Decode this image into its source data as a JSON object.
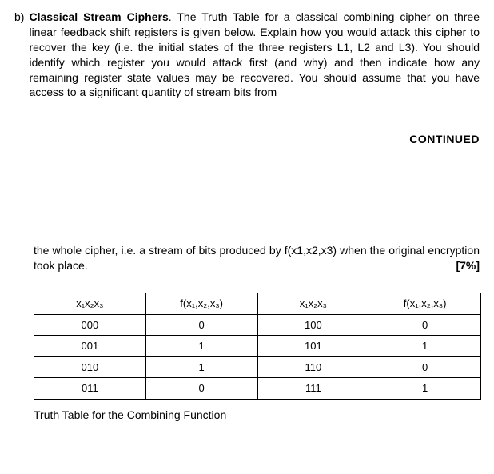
{
  "question": {
    "label": "b)",
    "title": "Classical Stream Ciphers",
    "text1": ". The Truth Table for a classical combining cipher on three linear feedback shift registers is given below. Explain how you would attack this cipher to recover the key (i.e. the initial states of the three registers L1, L2 and L3). You should identify which register you would attack first (and why) and then indicate how any remaining register state values may be recovered. You should assume that you have access to a significant quantity of stream bits from"
  },
  "continued": "CONTINUED",
  "para2": {
    "text": "the whole cipher, i.e. a stream of bits produced by f(x1,x2,x3) when the original encryption took place.",
    "marks": "[7%]"
  },
  "table": {
    "header_left_in": "x₁x₂x₃",
    "header_left_out": "f(x₁,x₂,x₃)",
    "header_right_in": "x₁x₂x₃",
    "header_right_out": "f(x₁,x₂,x₃)",
    "rows": [
      {
        "l_in": "000",
        "l_out": "0",
        "r_in": "100",
        "r_out": "0"
      },
      {
        "l_in": "001",
        "l_out": "1",
        "r_in": "101",
        "r_out": "1"
      },
      {
        "l_in": "010",
        "l_out": "1",
        "r_in": "110",
        "r_out": "0"
      },
      {
        "l_in": "011",
        "l_out": "0",
        "r_in": "111",
        "r_out": "1"
      }
    ],
    "caption": "Truth Table for the Combining Function"
  }
}
